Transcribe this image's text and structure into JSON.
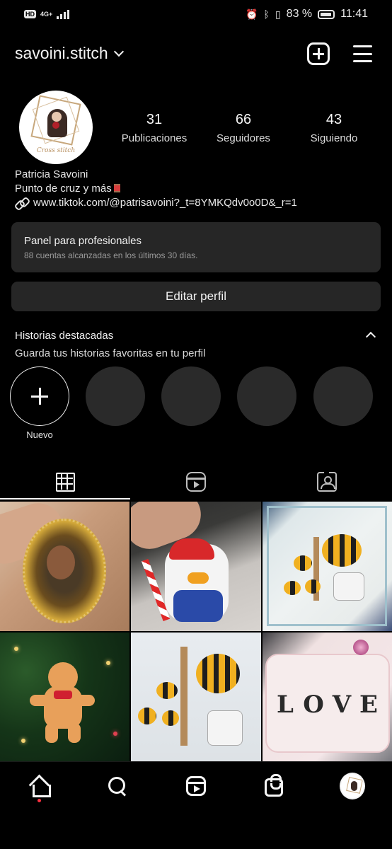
{
  "status_bar": {
    "hd": "HD",
    "network": "4G+",
    "battery_percent": "83 %",
    "time": "11:41"
  },
  "header": {
    "username": "savoini.stitch"
  },
  "profile": {
    "stats": {
      "posts_count": "31",
      "posts_label": "Publicaciones",
      "followers_count": "66",
      "followers_label": "Seguidores",
      "following_count": "43",
      "following_label": "Siguiendo"
    },
    "name": "Patricia Savoini",
    "bio": "Punto de cruz y más",
    "link": "www.tiktok.com/@patrisavoini?_t=8YMKQdv0o0D&_r=1",
    "avatar_logo_text": "Cross stitch"
  },
  "dashboard": {
    "title": "Panel para profesionales",
    "subtitle": "88 cuentas alcanzadas en los últimos 30 días."
  },
  "edit_profile_label": "Editar perfil",
  "highlights": {
    "title": "Historias destacadas",
    "subtitle": "Guarda tus historias favoritas en tu perfil",
    "new_label": "Nuevo",
    "empty_slots": 4
  },
  "tabs": [
    "grid-icon",
    "reels-icon",
    "tagged-icon"
  ],
  "posts": [
    "mona-lisa-ornament",
    "duck-santa-ornament",
    "bee-toilet-framed",
    "gingerbread-ornament",
    "bee-toilet-stitch",
    "love-potholder"
  ],
  "potholder_letters": [
    "L",
    "O",
    "V",
    "E"
  ],
  "bottom_nav": [
    "home-icon",
    "search-icon",
    "reels-icon",
    "shop-icon",
    "profile-avatar"
  ],
  "colors": {
    "background": "#000000",
    "surface": "#262626",
    "notification_dot": "#ff3040"
  }
}
